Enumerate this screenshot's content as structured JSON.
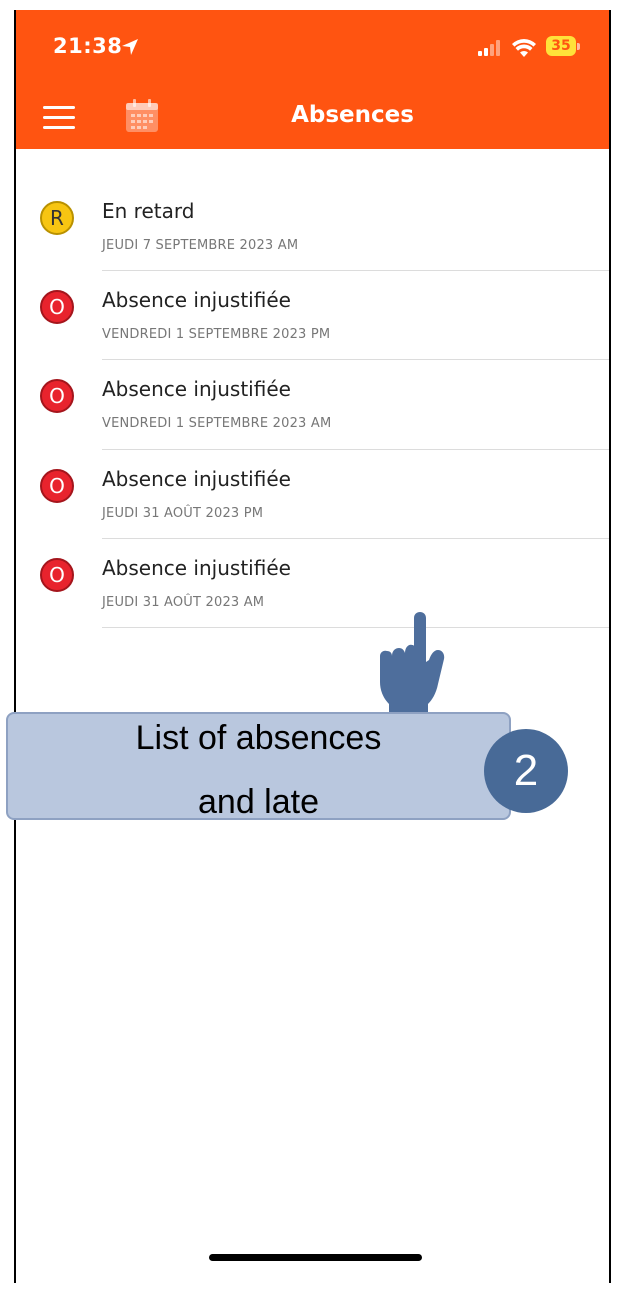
{
  "status_bar": {
    "time": "21:38",
    "battery": "35",
    "icons": [
      "location-arrow-icon",
      "signal-icon",
      "wifi-icon",
      "battery-icon"
    ]
  },
  "header": {
    "title": "Absences",
    "bg_color": "#ff5411",
    "icons": [
      "menu-icon",
      "calendar-icon"
    ]
  },
  "absences": [
    {
      "type": "late",
      "badge": "R",
      "title": "En retard",
      "date": "JEUDI 7 SEPTEMBRE 2023 AM"
    },
    {
      "type": "absence",
      "badge": "O",
      "title": "Absence injustifiée",
      "date": "VENDREDI 1 SEPTEMBRE 2023 PM"
    },
    {
      "type": "absence",
      "badge": "O",
      "title": "Absence injustifiée",
      "date": "VENDREDI 1 SEPTEMBRE 2023 AM"
    },
    {
      "type": "absence",
      "badge": "O",
      "title": "Absence injustifiée",
      "date": "JEUDI 31 AOÛT 2023 PM"
    },
    {
      "type": "absence",
      "badge": "O",
      "title": "Absence injustifiée",
      "date": "JEUDI 31 AOÛT 2023 AM"
    }
  ],
  "colors": {
    "late_badge": "#f7c512",
    "absence_badge": "#e8232d",
    "callout_bg": "#b9c7de",
    "step_badge": "#486a97"
  },
  "annotation": {
    "line1": "List of absences",
    "line2": "and late",
    "step": "2",
    "icon": "pointing-hand-icon"
  }
}
